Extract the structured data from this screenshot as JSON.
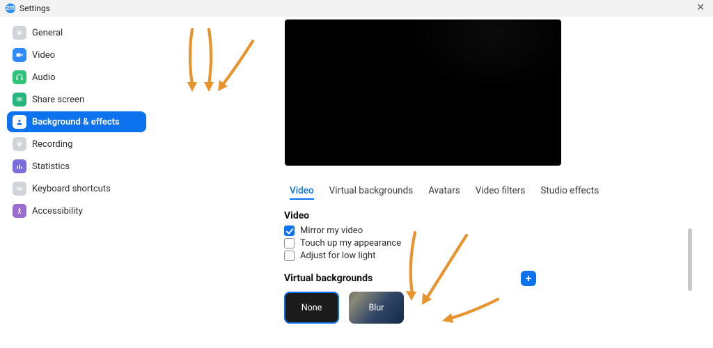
{
  "window": {
    "title": "Settings",
    "logo_text": "zm"
  },
  "sidebar": {
    "items": [
      {
        "label": "General",
        "icon": "gear-icon",
        "color": "ic-gray"
      },
      {
        "label": "Video",
        "icon": "camera-icon",
        "color": "ic-blue"
      },
      {
        "label": "Audio",
        "icon": "headphones-icon",
        "color": "ic-green"
      },
      {
        "label": "Share screen",
        "icon": "share-screen-icon",
        "color": "ic-green2"
      },
      {
        "label": "Background & effects",
        "icon": "person-icon",
        "color": "ic-blue",
        "active": true
      },
      {
        "label": "Recording",
        "icon": "record-icon",
        "color": "ic-gray"
      },
      {
        "label": "Statistics",
        "icon": "stats-icon",
        "color": "ic-purple"
      },
      {
        "label": "Keyboard shortcuts",
        "icon": "keyboard-icon",
        "color": "ic-gray"
      },
      {
        "label": "Accessibility",
        "icon": "accessibility-icon",
        "color": "ic-violet"
      }
    ]
  },
  "tabs": [
    {
      "label": "Video",
      "active": true
    },
    {
      "label": "Virtual backgrounds"
    },
    {
      "label": "Avatars"
    },
    {
      "label": "Video filters"
    },
    {
      "label": "Studio effects"
    }
  ],
  "video_section": {
    "heading": "Video",
    "options": [
      {
        "label": "Mirror my video",
        "checked": true
      },
      {
        "label": "Touch up my appearance",
        "checked": false
      },
      {
        "label": "Adjust for low light",
        "checked": false
      }
    ]
  },
  "vb_section": {
    "heading": "Virtual backgrounds",
    "thumbs": [
      {
        "label": "None",
        "kind": "none",
        "selected": true
      },
      {
        "label": "Blur",
        "kind": "blur"
      }
    ]
  }
}
